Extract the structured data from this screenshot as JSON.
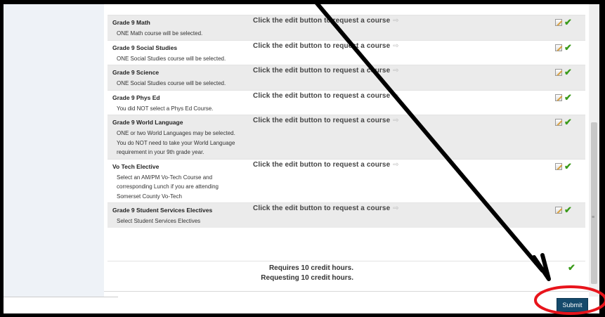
{
  "courses": [
    {
      "title": "Grade 9 Math",
      "desc": [
        "ONE Math course will be selected."
      ],
      "action": "Click the edit button to request a course",
      "shaded": true
    },
    {
      "title": "Grade 9 Social Studies",
      "desc": [
        "ONE Social Studies course will be selected."
      ],
      "action": "Click the edit button to request a course",
      "shaded": false
    },
    {
      "title": "Grade 9 Science",
      "desc": [
        "ONE Social Studies course will be selected."
      ],
      "action": "Click the edit button to request a course",
      "shaded": true
    },
    {
      "title": "Grade 9 Phys Ed",
      "desc": [
        "You did NOT select a Phys Ed Course."
      ],
      "action": "Click the edit button to request a course",
      "shaded": false
    },
    {
      "title": "Grade 9 World Language",
      "desc": [
        "ONE or two World Languages may be selected.",
        "You do NOT need to take your World Language",
        "requirement in your 9th grade year."
      ],
      "action": "Click the edit button to request a course",
      "shaded": true
    },
    {
      "title": "Vo Tech Elective",
      "desc": [
        "Select an AM/PM Vo-Tech Course and",
        "corresponding Lunch if you are attending",
        "Somerset County Vo-Tech"
      ],
      "action": "Click the edit button to request a course",
      "shaded": false
    },
    {
      "title": "Grade 9 Student Services Electives",
      "desc": [
        "Select Student Services Electives"
      ],
      "action": "Click the edit button to request a course",
      "shaded": true
    }
  ],
  "summary": {
    "required": "Requires 10 credit hours.",
    "requesting": "Requesting 10 credit hours."
  },
  "submit_label": "Submit",
  "icons": {
    "arrow": "arrow-right-icon",
    "edit": "edit-pencil-icon",
    "check": "checkmark-icon"
  },
  "colors": {
    "check": "#3a9a1a",
    "submit": "#154a6b",
    "annotation_circle": "#e8141b",
    "annotation_arrow": "#000000"
  }
}
